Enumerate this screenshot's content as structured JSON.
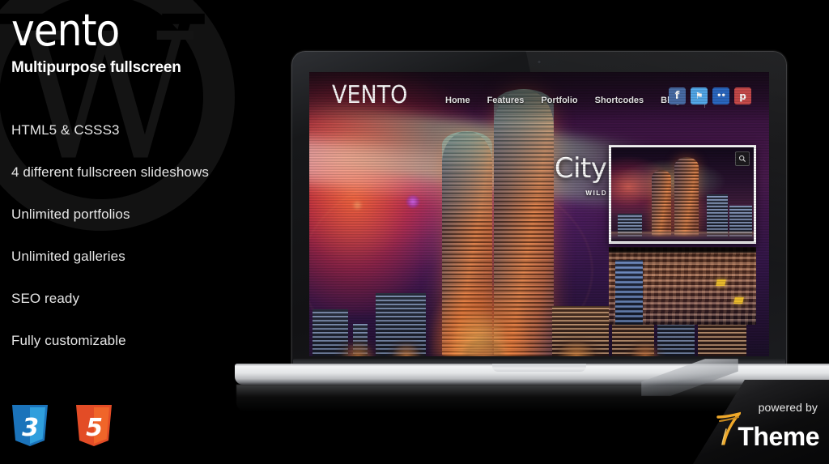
{
  "promo": {
    "logo": "vento",
    "logo_upper": "VENTO",
    "tagline": "Multipurpose fullscreen",
    "features": [
      "HTML5 & CSSS3",
      "4 different fullscreen slideshows",
      "Unlimited portfolios",
      "Unlimited galleries",
      "SEO ready",
      "Fully customizable"
    ],
    "badges": [
      {
        "name": "css3-badge",
        "label": "3",
        "color": "#1b73ba",
        "color_light": "#2f9fdd"
      },
      {
        "name": "html5-badge",
        "label": "5",
        "color": "#e34c26",
        "color_light": "#f06529"
      }
    ]
  },
  "site": {
    "logo": "VENTO",
    "nav": [
      "Home",
      "Features",
      "Portfolio",
      "Shortcodes",
      "Blog"
    ],
    "socials": [
      {
        "name": "facebook-icon",
        "glyph": "f",
        "color": "#4a6ea8"
      },
      {
        "name": "twitter-icon",
        "glyph": "⚑",
        "color": "#55acee"
      },
      {
        "name": "flickr-icon",
        "glyph": "••",
        "color": "#2b69c4"
      },
      {
        "name": "pinterest-icon",
        "glyph": "р",
        "color": "#cb4b4b"
      }
    ],
    "slide": {
      "title": "City nights",
      "subtitle": "WILD NIGHTS IN THE CITY"
    },
    "thumbnail": {
      "zoom_icon": "⚲"
    }
  },
  "footer": {
    "powered_by": "powered by",
    "brand": "Theme",
    "brand_mark": "7"
  },
  "colors": {
    "background": "#000000",
    "text": "#e6e6e6",
    "accent_orange": "#e0783c",
    "accent_purple": "#4a1b4e"
  }
}
